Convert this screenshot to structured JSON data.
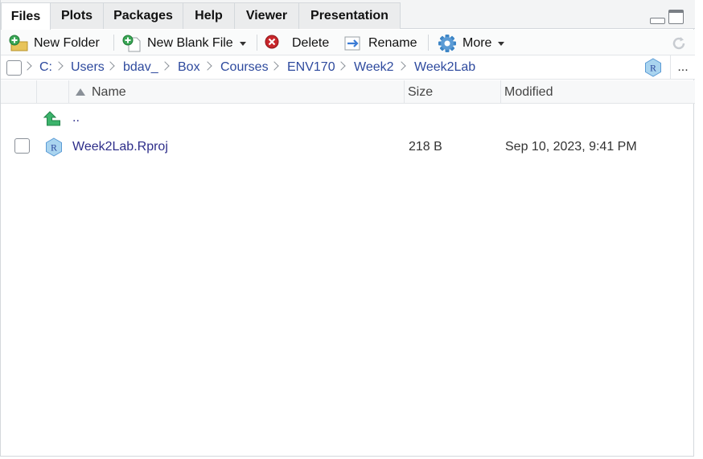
{
  "tabs": [
    {
      "label": "Files",
      "active": true
    },
    {
      "label": "Plots"
    },
    {
      "label": "Packages"
    },
    {
      "label": "Help"
    },
    {
      "label": "Viewer"
    },
    {
      "label": "Presentation"
    }
  ],
  "toolbar": {
    "new_folder": "New Folder",
    "new_blank_file": "New Blank File",
    "delete": "Delete",
    "rename": "Rename",
    "more": "More"
  },
  "breadcrumb": [
    "C:",
    "Users",
    "bdav_",
    "Box",
    "Courses",
    "ENV170",
    "Week2",
    "Week2Lab"
  ],
  "breadcrumb_more": "...",
  "columns": {
    "name": "Name",
    "size": "Size",
    "modified": "Modified"
  },
  "parent_row": {
    "name": ".."
  },
  "files": [
    {
      "name": "Week2Lab.Rproj",
      "size": "218 B",
      "modified": "Sep 10, 2023, 9:41 PM"
    }
  ],
  "colors": {
    "link": "#2e4a9e",
    "file_link": "#2e2e8a",
    "up_arrow": "#3bb36b"
  }
}
